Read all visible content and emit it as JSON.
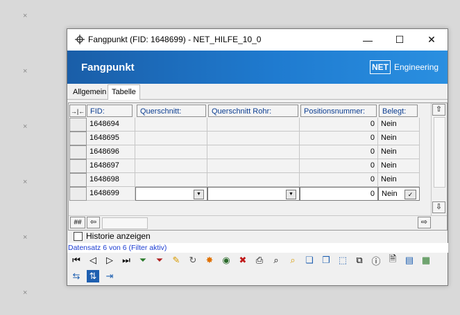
{
  "window": {
    "title": "Fangpunkt (FID: 1648699) - NET_HILFE_10_0",
    "controls": {
      "minimize": "—",
      "maximize": "☐",
      "close": "✕"
    }
  },
  "banner": {
    "title": "Fangpunkt",
    "logo_box": "NET",
    "logo_text": "Engineering",
    "colors": {
      "start": "#1a5ea8",
      "end": "#2a8fe0"
    }
  },
  "tabs": [
    {
      "label": "Allgemein",
      "active": false
    },
    {
      "label": "Tabelle",
      "active": true
    }
  ],
  "table": {
    "corner_button": "→|←",
    "columns": [
      "FID:",
      "Querschnitt:",
      "Querschnitt Rohr:",
      "Positionsnummer:",
      "Belegt:"
    ],
    "rows": [
      {
        "fid": "1648694",
        "querschnitt": "",
        "querschnitt_rohr": "",
        "positionsnummer": "0",
        "belegt": "Nein"
      },
      {
        "fid": "1648695",
        "querschnitt": "",
        "querschnitt_rohr": "",
        "positionsnummer": "0",
        "belegt": "Nein"
      },
      {
        "fid": "1648696",
        "querschnitt": "",
        "querschnitt_rohr": "",
        "positionsnummer": "0",
        "belegt": "Nein"
      },
      {
        "fid": "1648697",
        "querschnitt": "",
        "querschnitt_rohr": "",
        "positionsnummer": "0",
        "belegt": "Nein"
      },
      {
        "fid": "1648698",
        "querschnitt": "",
        "querschnitt_rohr": "",
        "positionsnummer": "0",
        "belegt": "Nein"
      },
      {
        "fid": "1648699",
        "querschnitt": "",
        "querschnitt_rohr": "",
        "positionsnummer": "0",
        "belegt": "Nein"
      }
    ],
    "footer_button": "##"
  },
  "history_checkbox": {
    "label": "Historie anzeigen",
    "checked": false
  },
  "status": {
    "text": "Datensatz 6 von 6 (Filter aktiv)",
    "color": "#1a3bd1"
  },
  "toolbar_icons": [
    "first-record-icon",
    "previous-record-icon",
    "next-record-icon",
    "last-record-icon",
    "add-filter-icon",
    "remove-filter-icon",
    "edit-pencil-icon",
    "refresh-icon",
    "highlight-icon",
    "zoom-to-icon",
    "delete-icon",
    "print-icon",
    "search-icon",
    "search-highlight-icon",
    "copy-icon",
    "copy-multiple-icon",
    "select-icon",
    "duplicate-icon",
    "info-icon",
    "document-icon",
    "export-icon",
    "add-document-icon",
    "split-icon",
    "sort-icon",
    "exit-icon"
  ]
}
